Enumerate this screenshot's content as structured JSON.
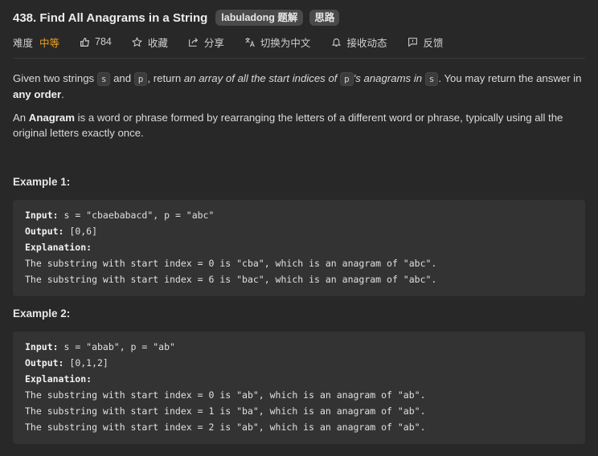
{
  "problem": {
    "title": "438. Find All Anagrams in a String",
    "tags": [
      "labuladong 题解",
      "思路"
    ]
  },
  "meta": {
    "difficulty_label": "难度",
    "difficulty": "中等",
    "likes": "784",
    "favorite": "收藏",
    "share": "分享",
    "switch_lang": "切换为中文",
    "receive_updates": "接收动态",
    "feedback": "反馈"
  },
  "description": {
    "p1_a": "Given two strings ",
    "code_s": "s",
    "p1_b": " and ",
    "code_p": "p",
    "p1_c": ", return ",
    "p1_italic1": "an array of all the start indices of ",
    "p1_italic2": "'s anagrams in ",
    "p1_d": ". You may return the answer in ",
    "p1_bold": "any order",
    "p1_e": ".",
    "p2_a": "An ",
    "p2_bold": "Anagram",
    "p2_b": " is a word or phrase formed by rearranging the letters of a different word or phrase, typically using all the original letters exactly once."
  },
  "examples": [
    {
      "title": "Example 1:",
      "input_label": "Input:",
      "input": " s = \"cbaebabacd\", p = \"abc\"",
      "output_label": "Output:",
      "output": " [0,6]",
      "explanation_label": "Explanation:",
      "lines": [
        "The substring with start index = 0 is \"cba\", which is an anagram of \"abc\".",
        "The substring with start index = 6 is \"bac\", which is an anagram of \"abc\"."
      ]
    },
    {
      "title": "Example 2:",
      "input_label": "Input:",
      "input": " s = \"abab\", p = \"ab\"",
      "output_label": "Output:",
      "output": " [0,1,2]",
      "explanation_label": "Explanation:",
      "lines": [
        "The substring with start index = 0 is \"ab\", which is an anagram of \"ab\".",
        "The substring with start index = 1 is \"ba\", which is an anagram of \"ab\".",
        "The substring with start index = 2 is \"ab\", which is an anagram of \"ab\"."
      ]
    }
  ],
  "colors": {
    "background": "#282828",
    "difficulty_medium": "#f0a020",
    "code_block": "#333333",
    "tag_bg": "#4a4a4a"
  },
  "icons": [
    "thumb-up-icon",
    "star-icon",
    "share-icon",
    "translate-icon",
    "bell-icon",
    "feedback-icon"
  ]
}
